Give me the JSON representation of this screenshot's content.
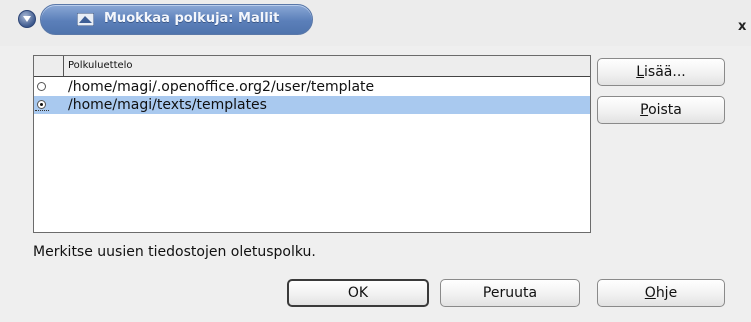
{
  "window": {
    "title": "Muokkaa polkuja: Mallit",
    "close_glyph": "x"
  },
  "list": {
    "header": "Polkuluettelo",
    "rows": [
      {
        "path": "/home/magi/.openoffice.org2/user/template",
        "selected": false
      },
      {
        "path": "/home/magi/texts/templates",
        "selected": true
      }
    ]
  },
  "buttons": {
    "add": {
      "underline": "L",
      "rest": "isää..."
    },
    "remove": {
      "underline": "P",
      "rest": "oista"
    },
    "ok": "OK",
    "cancel": "Peruuta",
    "help": {
      "underline": "O",
      "rest": "hje"
    }
  },
  "hint": "Merkitse uusien tiedostojen oletuspolku.",
  "colors": {
    "selection": "#a9c9ef",
    "titlebar_accent": "#5b7fb9"
  },
  "icons": [
    "window-menu-icon",
    "app-icon",
    "close-icon",
    "radio-icon"
  ]
}
